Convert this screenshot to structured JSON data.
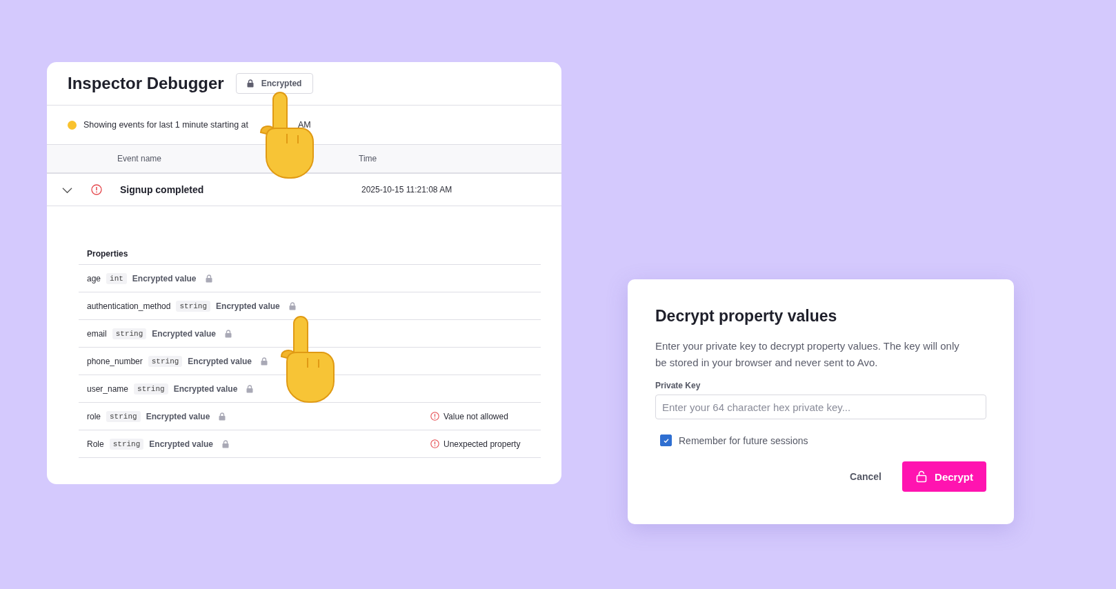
{
  "inspector": {
    "title": "Inspector Debugger",
    "badge": {
      "label": "Encrypted"
    },
    "status": {
      "color": "#f9c22e",
      "text": "Showing events for last 1 minute starting at",
      "text_end": "AM"
    },
    "table": {
      "columns": [
        "Event name",
        "Time"
      ],
      "rows": [
        {
          "expanded": true,
          "error": true,
          "event_name": "Signup completed",
          "time": "2025-10-15 11:21:08 AM"
        }
      ]
    },
    "properties": {
      "title": "Properties",
      "rows": [
        {
          "name": "age",
          "type": "int",
          "value": "Encrypted value"
        },
        {
          "name": "authentication_method",
          "type": "string",
          "value": "Encrypted value"
        },
        {
          "name": "email",
          "type": "string",
          "value": "Encrypted value"
        },
        {
          "name": "phone_number",
          "type": "string",
          "value": "Encrypted value"
        },
        {
          "name": "user_name",
          "type": "string",
          "value": "Encrypted value"
        },
        {
          "name": "role",
          "type": "string",
          "value": "Encrypted value",
          "issue": "Value not allowed"
        },
        {
          "name": "Role",
          "type": "string",
          "value": "Encrypted value",
          "issue": "Unexpected property"
        }
      ]
    }
  },
  "dialog": {
    "title": "Decrypt property values",
    "description": "Enter your private key to decrypt property values. The key will only be stored in your browser and never sent to Avo.",
    "field": {
      "label": "Private Key",
      "placeholder": "Enter your 64 character hex private key..."
    },
    "remember": {
      "label": "Remember for future sessions",
      "checked": true
    },
    "buttons": {
      "cancel": "Cancel",
      "decrypt": "Decrypt"
    }
  }
}
